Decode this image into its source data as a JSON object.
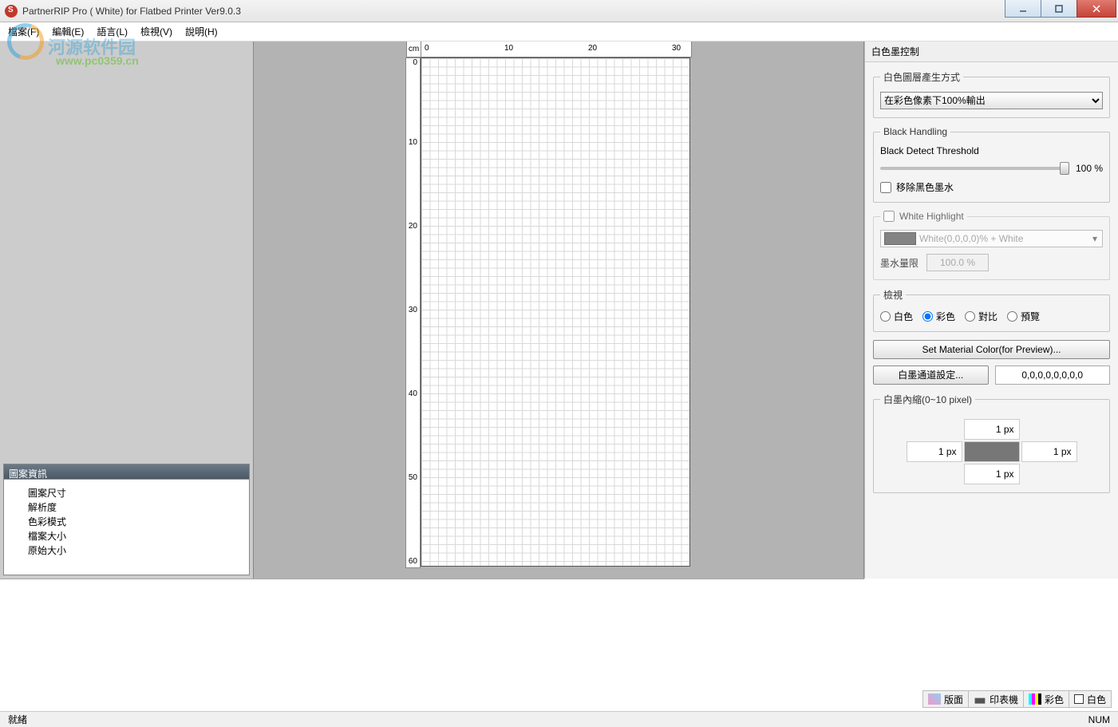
{
  "title": "PartnerRIP Pro ( White) for Flatbed Printer Ver9.0.3",
  "watermark": {
    "text": "河源软件园",
    "url": "www.pc0359.cn"
  },
  "menu": {
    "file": "檔案(F)",
    "edit": "編輯(E)",
    "lang": "語言(L)",
    "view": "檢視(V)",
    "help": "說明(H)"
  },
  "ruler": {
    "unit": "cm",
    "h": [
      "0",
      "10",
      "20",
      "30"
    ],
    "v": [
      "0",
      "10",
      "20",
      "30",
      "40",
      "50",
      "60"
    ]
  },
  "leftpanel": {
    "header": "圖案資訊",
    "rows": [
      "圖案尺寸",
      "解析度",
      "色彩模式",
      "檔案大小",
      "原始大小"
    ]
  },
  "rightpanel": {
    "title": "白色墨控制",
    "gen_legend": "白色圖層產生方式",
    "gen_select": "在彩色像素下100%輸出",
    "black_legend": "Black Handling",
    "black_thresh_label": "Black Detect Threshold",
    "black_thresh_val": "100 %",
    "remove_black": "移除黑色墨水",
    "white_hl": "White Highlight",
    "white_sel": "White(0,0,0,0)% + White",
    "ink_limit_label": "墨水量限",
    "ink_limit_val": "100.0 %",
    "view_legend": "檢視",
    "radios": {
      "white": "白色",
      "color": "彩色",
      "diff": "對比",
      "preview": "預覽"
    },
    "btn_material": "Set Material Color(for Preview)...",
    "btn_whitech": "白墨通道設定...",
    "whitech_val": "0,0,0,0,0,0,0,0",
    "shrink_legend": "白墨內縮(0~10 pixel)",
    "shrink_vals": {
      "t": "1 px",
      "l": "1 px",
      "r": "1 px",
      "b": "1 px"
    }
  },
  "bottom_tabs": {
    "layout": "版面",
    "printer": "印表機",
    "color": "彩色",
    "white": "白色"
  },
  "status": {
    "ready": "就緒",
    "num": "NUM"
  }
}
